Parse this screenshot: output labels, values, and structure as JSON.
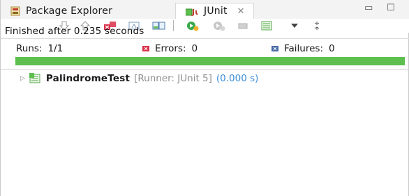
{
  "tabs": [
    {
      "label": "Package Explorer",
      "icon": "package-explorer-icon",
      "active": false
    },
    {
      "label": "JUnit",
      "icon": "junit-icon",
      "active": true,
      "close_glyph": "✕"
    }
  ],
  "window_controls": {
    "minimize": "▭",
    "maximize": "☐"
  },
  "toolbar": {
    "icons": [
      "next-failure-icon",
      "previous-failure-icon",
      "show-failures-only-icon",
      "scroll-lock-icon",
      "layout-icon",
      "rerun-test-icon",
      "rerun-failed-first-icon",
      "stop-icon",
      "test-run-history-icon",
      "view-menu-icon",
      "more-icon"
    ]
  },
  "status": "Finished after 0.235 seconds",
  "counters": {
    "runs": {
      "label": "Runs:",
      "value": "1/1"
    },
    "errors": {
      "label": "Errors:",
      "value": "0"
    },
    "failures": {
      "label": "Failures:",
      "value": "0"
    }
  },
  "progress": {
    "fraction": 1.0,
    "color": "#5cbf4e"
  },
  "tree": [
    {
      "name": "PalindromeTest",
      "runner": "[Runner: JUnit 5]",
      "time": "(0.000 s)",
      "status": "passed",
      "expanded": false
    }
  ],
  "colors": {
    "accent_green": "#5cbf4e",
    "error_red": "#d9304a",
    "time_blue": "#3a8dd6",
    "runner_gray": "#8f8f8f"
  }
}
